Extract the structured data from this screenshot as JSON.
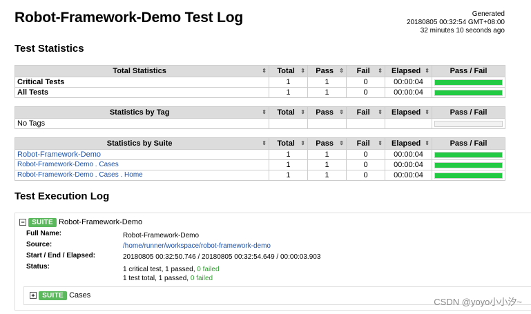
{
  "header": {
    "title": "Robot-Framework-Demo Test Log",
    "generated_label": "Generated",
    "generated_time": "20180805 00:32:54 GMT+08:00",
    "generated_ago": "32 minutes 10 seconds ago"
  },
  "test_statistics": {
    "title": "Test Statistics",
    "columns": [
      "Total",
      "Pass",
      "Fail",
      "Elapsed",
      "Pass / Fail"
    ],
    "sort_glyph": "⇕",
    "total": {
      "header": "Total Statistics",
      "rows": [
        {
          "name": "Critical Tests",
          "total": "1",
          "pass": "1",
          "fail": "0",
          "elapsed": "00:00:04",
          "pass_fraction": 1.0
        },
        {
          "name": "All Tests",
          "total": "1",
          "pass": "1",
          "fail": "0",
          "elapsed": "00:00:04",
          "pass_fraction": 1.0
        }
      ]
    },
    "by_tag": {
      "header": "Statistics by Tag",
      "rows": [
        {
          "name": "No Tags",
          "pass_fraction": 0
        }
      ]
    },
    "by_suite": {
      "header": "Statistics by Suite",
      "rows": [
        {
          "name": "Robot-Framework-Demo",
          "total": "1",
          "pass": "1",
          "fail": "0",
          "elapsed": "00:00:04",
          "pass_fraction": 1.0
        },
        {
          "name": "Robot-Framework-Demo . Cases",
          "total": "1",
          "pass": "1",
          "fail": "0",
          "elapsed": "00:00:04",
          "pass_fraction": 1.0
        },
        {
          "name": "Robot-Framework-Demo . Cases . Home",
          "total": "1",
          "pass": "1",
          "fail": "0",
          "elapsed": "00:00:04",
          "pass_fraction": 1.0
        }
      ]
    }
  },
  "execution_log": {
    "title": "Test Execution Log",
    "suite": {
      "toggle": "−",
      "badge": "SUITE",
      "name": "Robot-Framework-Demo",
      "full_name_label": "Full Name:",
      "full_name": "Robot-Framework-Demo",
      "source_label": "Source:",
      "source": "/home/runner/workspace/robot-framework-demo",
      "times_label": "Start / End / Elapsed:",
      "times": "20180805 00:32:50.746 / 20180805 00:32:54.649 / 00:00:03.903",
      "status_label": "Status:",
      "status_line1_prefix": "1 critical test, 1 passed, ",
      "status_line1_failed": "0 failed",
      "status_line2_prefix": "1 test total, 1 passed, ",
      "status_line2_failed": "0 failed"
    },
    "child_suite": {
      "toggle": "+",
      "badge": "SUITE",
      "name": "Cases"
    }
  },
  "watermark": "CSDN @yoyo小小汐~",
  "colors": {
    "pass_bar": "#22c942",
    "suite_badge": "#5cb85c",
    "link": "#1a4fa6",
    "header_bg": "#dcdcdc"
  }
}
